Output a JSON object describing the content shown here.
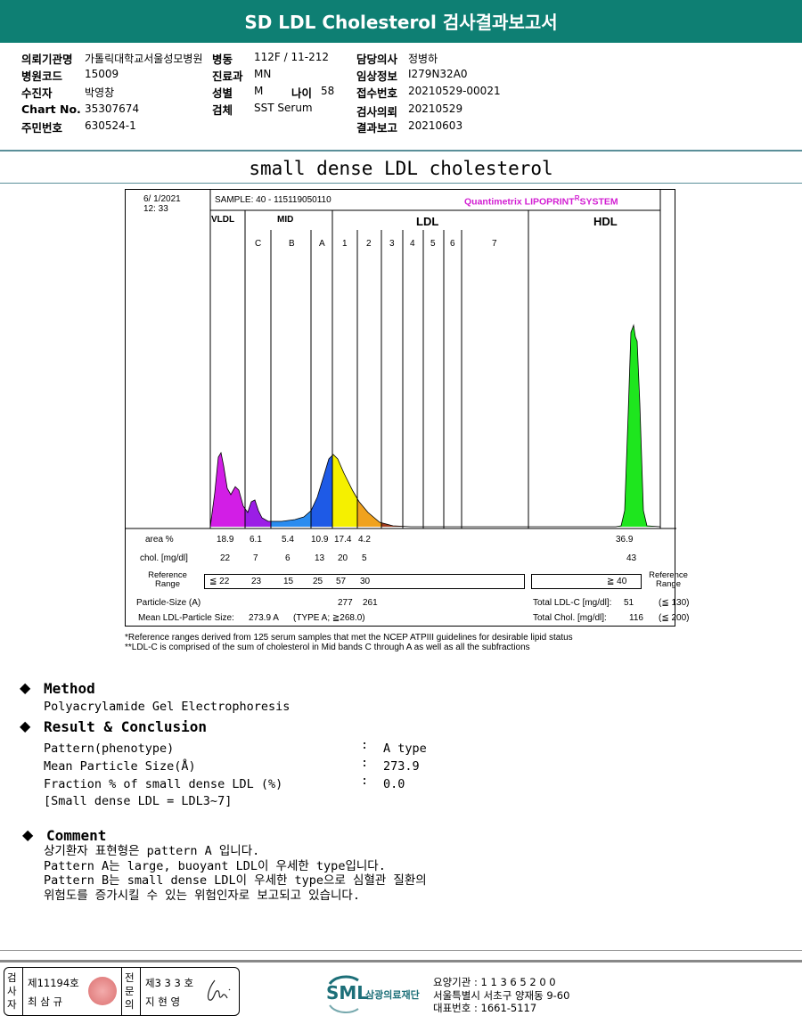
{
  "title": "SD LDL Cholesterol 검사결과보고서",
  "patient": {
    "hospital": {
      "label": "의뢰기관명",
      "value": "가톨릭대학교서울성모병원"
    },
    "ward": {
      "label": "병동",
      "value": "112F / 11-212"
    },
    "doctor": {
      "label": "담당의사",
      "value": "정병하"
    },
    "code": {
      "label": "병원코드",
      "value": "15009"
    },
    "dept": {
      "label": "진료과",
      "value": "MN"
    },
    "clinical": {
      "label": "임상정보",
      "value": "I279N32A0"
    },
    "name": {
      "label": "수진자",
      "value": "박영창"
    },
    "sex": {
      "label": "성별",
      "value": "M"
    },
    "age": {
      "label": "나이",
      "value": "58"
    },
    "receipt": {
      "label": "접수번호",
      "value": "20210529-00021"
    },
    "chart": {
      "label": "Chart No.",
      "value": "35307674"
    },
    "specimen": {
      "label": "검체",
      "value": "SST Serum"
    },
    "request": {
      "label": "검사의뢰",
      "value": "20210529"
    },
    "id": {
      "label": "주민번호",
      "value": "630524-1"
    },
    "report": {
      "label": "결과보고",
      "value": "20210603"
    }
  },
  "subtitle": "small dense LDL cholesterol",
  "lipoprint": {
    "date": "6/  1/2021",
    "time": "12:  33",
    "sample": "SAMPLE:    40 - 115119050110",
    "brand": "Quantimetrix LIPOPRINT",
    "brand_mark": "R",
    "brand_suffix": "SYSTEM",
    "groups": [
      "VLDL",
      "MID",
      "LDL",
      "HDL"
    ],
    "bands": [
      "C",
      "B",
      "A",
      "1",
      "2",
      "3",
      "4",
      "5",
      "6",
      "7"
    ],
    "band_colors": {
      "VLDL": "#d21ee6",
      "C": "#9b1ee6",
      "B": "#2a8cf0",
      "A": "#1e5ae6",
      "1": "#f5f000",
      "2": "#f0a21e",
      "3": "#a03c1e",
      "HDL": "#1ee61e"
    },
    "rows": {
      "area_label": "area %",
      "area": [
        "18.9",
        "6.1",
        "5.4",
        "10.9",
        "17.4",
        "4.2"
      ],
      "area_hdl": "36.9",
      "chol_label": "chol. [mg/dl]",
      "chol": [
        "22",
        "7",
        "6",
        "13",
        "20",
        "5"
      ],
      "chol_hdl": "43",
      "ref_label": "Reference Range",
      "ref": [
        "≦ 22",
        "23",
        "15",
        "25",
        "57",
        "30"
      ],
      "ref_hdl": "≧  40",
      "ref_label_right": "Reference Range",
      "particle_label": "Particle-Size (A)",
      "particle": [
        "277",
        "261"
      ],
      "mean_label": "Mean LDL-Particle Size:",
      "mean_value": "273.9  A",
      "mean_type": "(TYPE A; ≧268.0)",
      "total_ldl_label": "Total LDL-C [mg/dl]:",
      "total_ldl": "51",
      "total_ldl_ref": "(≦ 130)",
      "total_chol_label": "Total Chol. [mg/dl]:",
      "total_chol": "116",
      "total_chol_ref": "(≦ 200)"
    },
    "notes": [
      "*Reference ranges derived from 125 serum samples that met the NCEP ATPIII guidelines for desirable lipid status",
      "**LDL-C is comprised of the sum of cholesterol in Mid bands C through A as well as all the subfractions"
    ]
  },
  "method": {
    "heading": "Method",
    "text": "Polyacrylamide Gel Electrophoresis"
  },
  "result": {
    "heading": "Result & Conclusion",
    "items": [
      {
        "label": "Pattern(phenotype)",
        "value": "A type"
      },
      {
        "label": "Mean Particle Size(Å)",
        "value": "273.9"
      },
      {
        "label": "Fraction % of small dense LDL (%)",
        "value": "0.0"
      }
    ],
    "note": "[Small dense LDL = LDL3~7]"
  },
  "comment": {
    "heading": "Comment",
    "lines": [
      "상기환자 표현형은 pattern A 입니다.",
      "Pattern A는 large, buoyant LDL이 우세한 type입니다.",
      "Pattern B는 small dense LDL이 우세한 type으로 심혈관 질환의",
      "위험도를 증가시킬 수 있는 위험인자로 보고되고 있습니다."
    ]
  },
  "footer": {
    "examiner_label": "검사자",
    "examiner_no": "제11194호",
    "examiner_name": "최 삼 규",
    "specialist_label": "전문의",
    "specialist_no": "제3 3 3 호",
    "specialist_name": "지 현 영",
    "logo": "SML",
    "org": "삼광의료재단",
    "inst": "요양기관 : 1 1 3 6 5 2 0 0",
    "address": "서울특별시 서초구 양재동 9-60",
    "phone": "대표번호 : 1661-5117",
    "accent": "#1c6f78"
  }
}
